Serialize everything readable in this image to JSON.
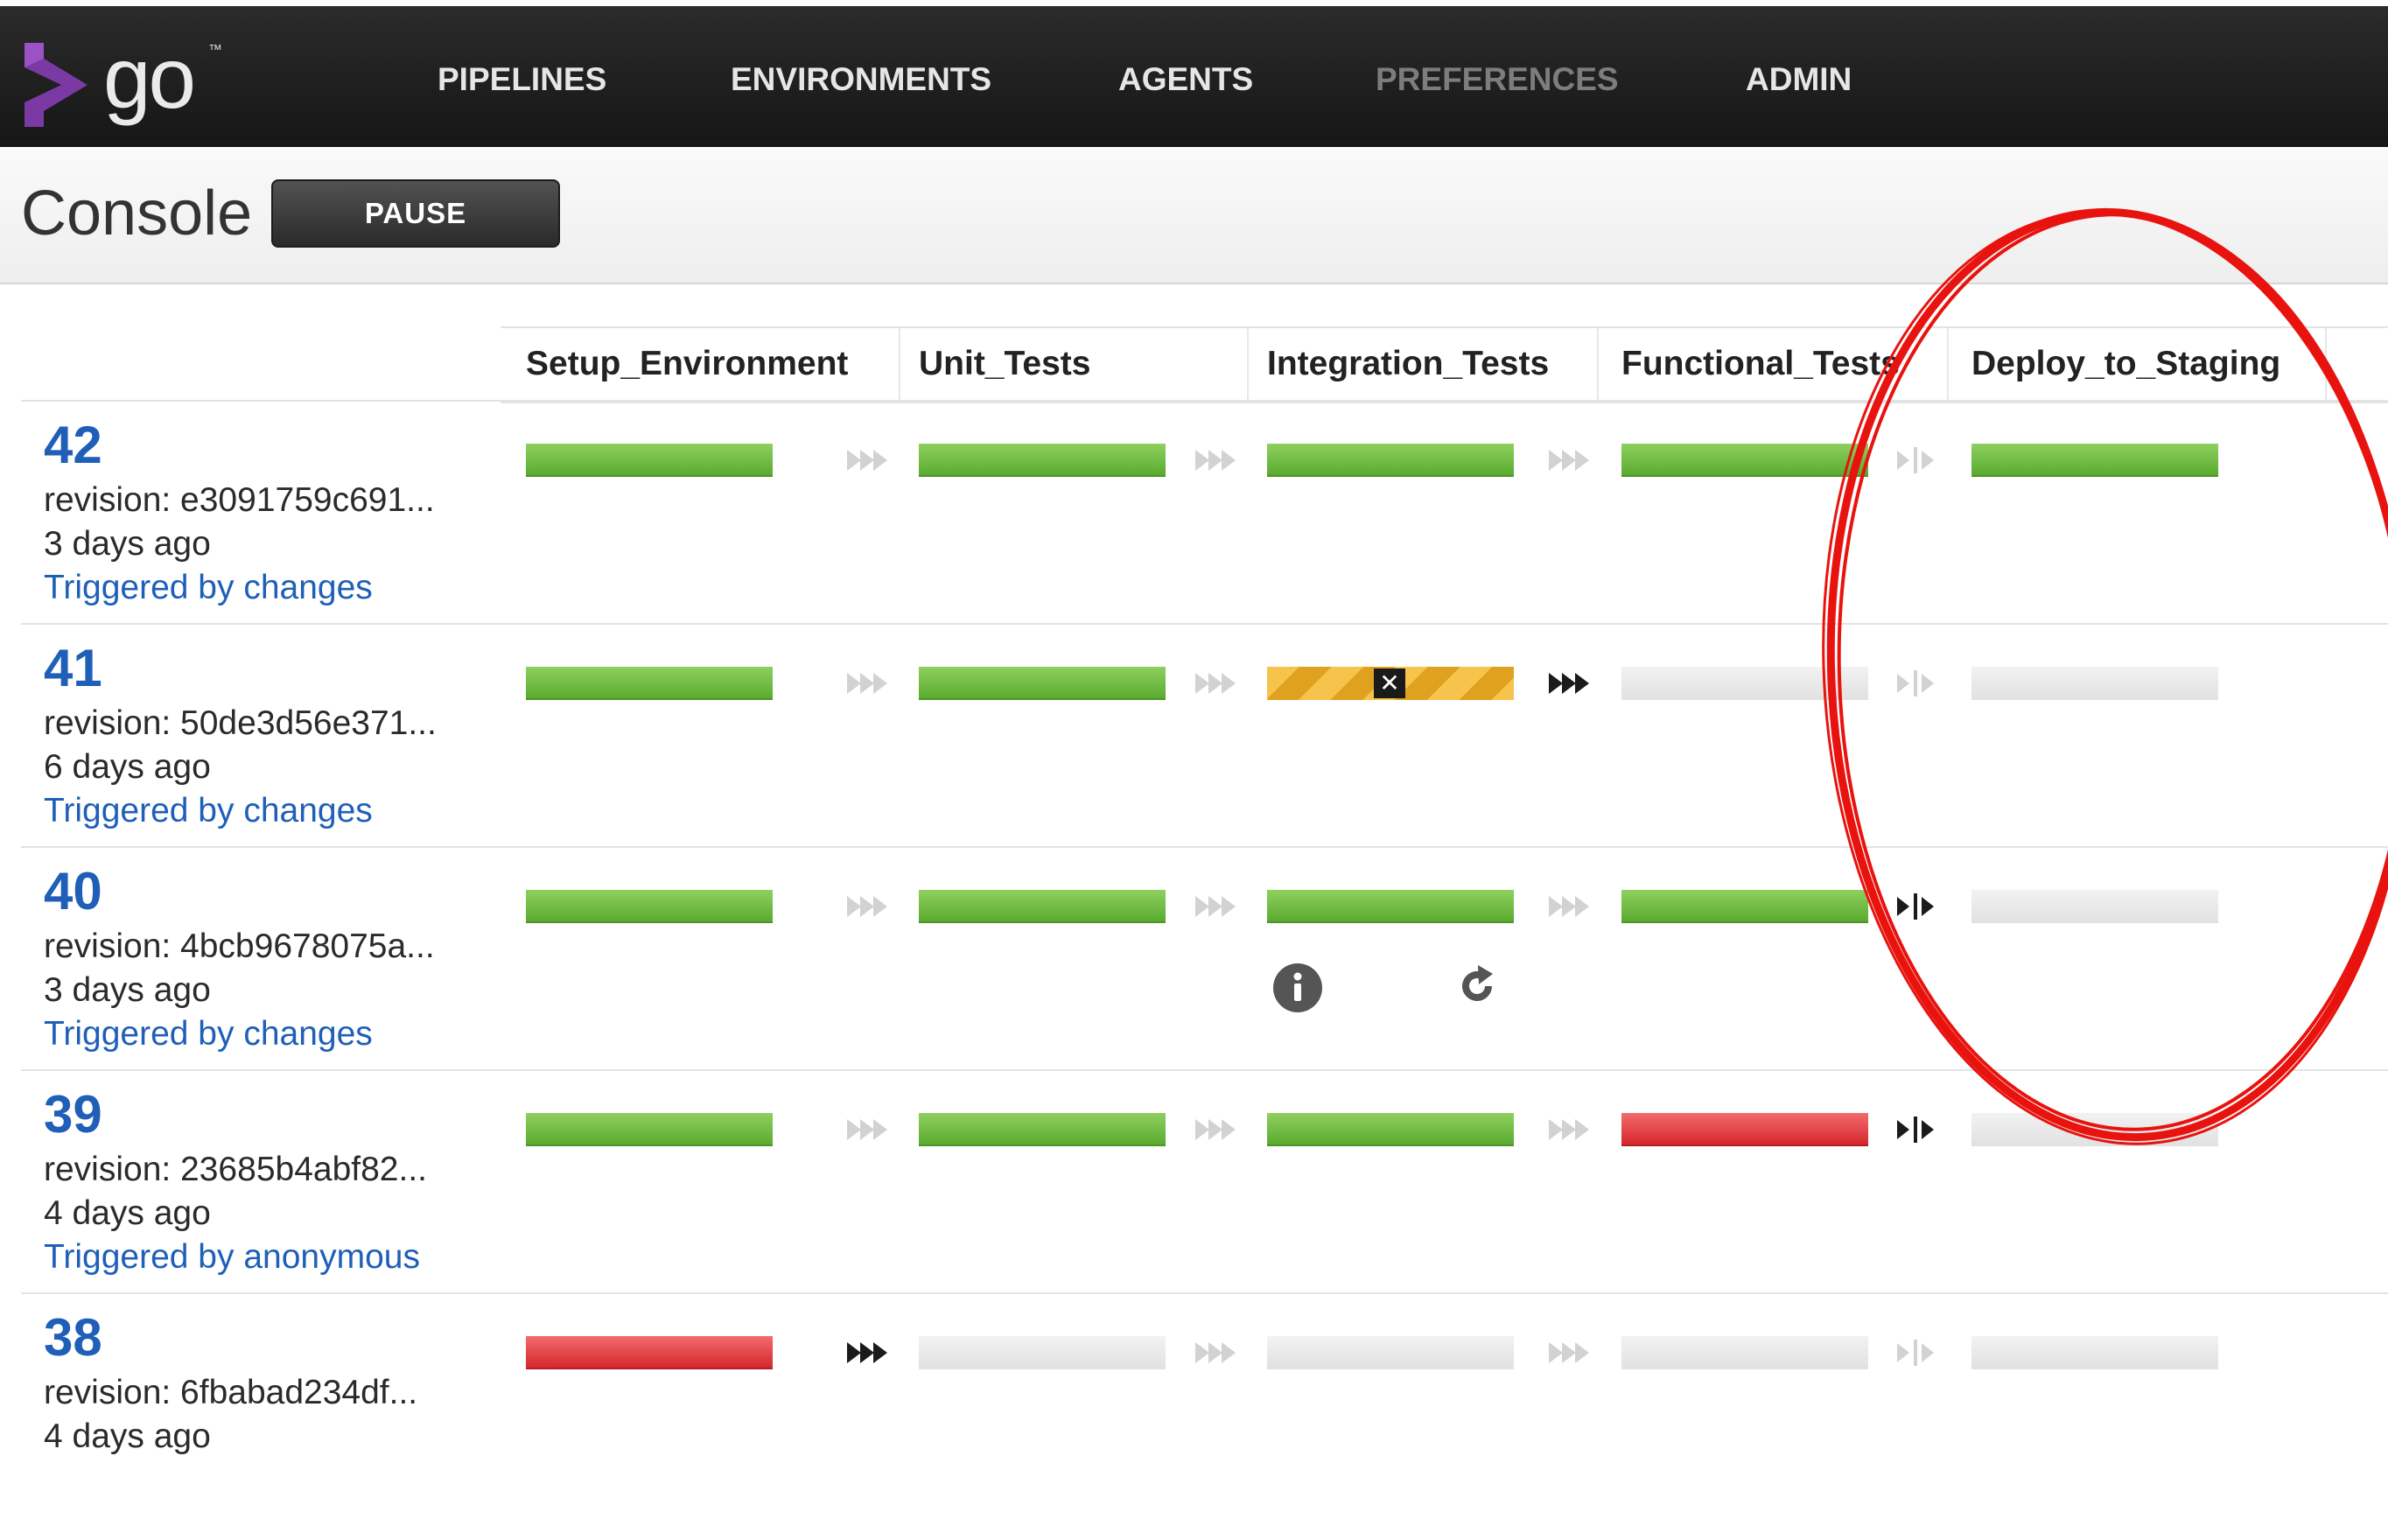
{
  "app": {
    "logo_text": "go",
    "logo_tm": "™",
    "nav": [
      {
        "label": "PIPELINES"
      },
      {
        "label": "ENVIRONMENTS"
      },
      {
        "label": "AGENTS"
      },
      {
        "label": "PREFERENCES"
      },
      {
        "label": "ADMIN"
      }
    ]
  },
  "header": {
    "title": "Console",
    "pause_label": "PAUSE"
  },
  "stages": [
    {
      "name": "Setup_Environment"
    },
    {
      "name": "Unit_Tests"
    },
    {
      "name": "Integration_Tests"
    },
    {
      "name": "Functional_Tests"
    },
    {
      "name": "Deploy_to_Staging"
    }
  ],
  "runs": [
    {
      "counter": "42",
      "revision": "revision: e3091759c691...",
      "age": "3 days ago",
      "trigger": "Triggered by changes",
      "stage_status": [
        "passed",
        "passed",
        "passed",
        "passed",
        "passed"
      ],
      "transitions": [
        "auto-dim",
        "auto-dim",
        "auto-dim",
        "manual-dim"
      ]
    },
    {
      "counter": "41",
      "revision": "revision: 50de3d56e371...",
      "age": "6 days ago",
      "trigger": "Triggered by changes",
      "stage_status": [
        "passed",
        "passed",
        "cancelled",
        "unknown",
        "unknown"
      ],
      "transitions": [
        "auto-dim",
        "auto-dim",
        "auto-dark",
        "manual-dim"
      ]
    },
    {
      "counter": "40",
      "revision": "revision: 4bcb9678075a...",
      "age": "3 days ago",
      "trigger": "Triggered by changes",
      "stage_status": [
        "passed",
        "passed",
        "passed",
        "passed",
        "unknown"
      ],
      "transitions": [
        "auto-dim",
        "auto-dim",
        "auto-dim",
        "manual-dark"
      ],
      "stage_actions": [
        "info-icon",
        "rerun-icon"
      ]
    },
    {
      "counter": "39",
      "revision": "revision: 23685b4abf82...",
      "age": "4 days ago",
      "trigger": "Triggered by anonymous",
      "stage_status": [
        "passed",
        "passed",
        "passed",
        "failed",
        "unknown"
      ],
      "transitions": [
        "auto-dim",
        "auto-dim",
        "auto-dim",
        "manual-dark"
      ]
    },
    {
      "counter": "38",
      "revision": "revision: 6fbabad234df...",
      "age": "4 days ago",
      "trigger": "",
      "stage_status": [
        "failed",
        "unknown",
        "unknown",
        "unknown",
        "unknown"
      ],
      "transitions": [
        "auto-dark",
        "auto-dim",
        "auto-dim",
        "manual-dim"
      ]
    }
  ],
  "colors": {
    "passed": "#6bbd3c",
    "failed": "#e0353a",
    "cancelled": "#f0b433",
    "unknown": "#e6e6e6",
    "link": "#1f5fb8",
    "annotation": "#e8130e"
  },
  "annotation": {
    "shape": "hand-drawn-ellipse",
    "color": "#e8130e"
  }
}
